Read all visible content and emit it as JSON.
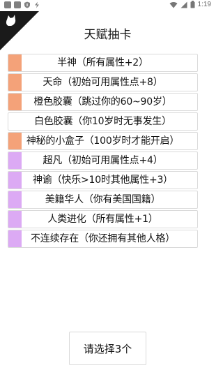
{
  "status_bar": {
    "time": "1:19",
    "left_icons": [
      "notification-square-icon",
      "notification-square-icon",
      "shield-icon",
      "bolt-icon"
    ],
    "right_icons": [
      "wifi-icon",
      "signal-icon",
      "battery-icon"
    ]
  },
  "page": {
    "title": "天赋抽卡"
  },
  "colors": {
    "tag_orange": "#f4a279",
    "tag_purple": "#dcaaf4"
  },
  "cards": [
    {
      "label": "半神（所有属性+2）",
      "tag": "orange"
    },
    {
      "label": "天命（初始可用属性点+8）",
      "tag": "orange"
    },
    {
      "label": "橙色胶囊（跳过你的60~90岁）",
      "tag": "orange"
    },
    {
      "label": "白色胶囊（你10岁时无事发生）",
      "tag": "none"
    },
    {
      "label": "神秘的小盒子（100岁时才能开启）",
      "tag": "orange"
    },
    {
      "label": "超凡（初始可用属性点+4）",
      "tag": "purple"
    },
    {
      "label": "神谕（快乐>10时其他属性+3）",
      "tag": "purple"
    },
    {
      "label": "美籍华人（你有美国国籍）",
      "tag": "purple"
    },
    {
      "label": "人类进化（所有属性+1）",
      "tag": "purple"
    },
    {
      "label": "不连续存在（你还拥有其他人格）",
      "tag": "purple"
    }
  ],
  "footer": {
    "button_label": "请选择3个"
  }
}
